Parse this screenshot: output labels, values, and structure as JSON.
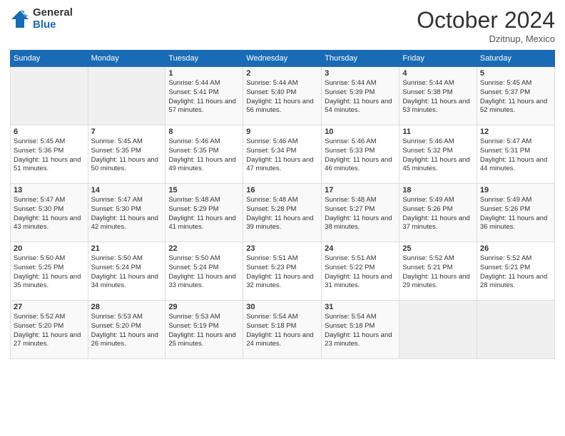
{
  "logo": {
    "general": "General",
    "blue": "Blue"
  },
  "header": {
    "month": "October 2024",
    "location": "Dzitnup, Mexico"
  },
  "weekdays": [
    "Sunday",
    "Monday",
    "Tuesday",
    "Wednesday",
    "Thursday",
    "Friday",
    "Saturday"
  ],
  "weeks": [
    [
      {
        "day": "",
        "sunrise": "",
        "sunset": "",
        "daylight": ""
      },
      {
        "day": "",
        "sunrise": "",
        "sunset": "",
        "daylight": ""
      },
      {
        "day": "1",
        "sunrise": "Sunrise: 5:44 AM",
        "sunset": "Sunset: 5:41 PM",
        "daylight": "Daylight: 11 hours and 57 minutes."
      },
      {
        "day": "2",
        "sunrise": "Sunrise: 5:44 AM",
        "sunset": "Sunset: 5:40 PM",
        "daylight": "Daylight: 11 hours and 56 minutes."
      },
      {
        "day": "3",
        "sunrise": "Sunrise: 5:44 AM",
        "sunset": "Sunset: 5:39 PM",
        "daylight": "Daylight: 11 hours and 54 minutes."
      },
      {
        "day": "4",
        "sunrise": "Sunrise: 5:44 AM",
        "sunset": "Sunset: 5:38 PM",
        "daylight": "Daylight: 11 hours and 53 minutes."
      },
      {
        "day": "5",
        "sunrise": "Sunrise: 5:45 AM",
        "sunset": "Sunset: 5:37 PM",
        "daylight": "Daylight: 11 hours and 52 minutes."
      }
    ],
    [
      {
        "day": "6",
        "sunrise": "Sunrise: 5:45 AM",
        "sunset": "Sunset: 5:36 PM",
        "daylight": "Daylight: 11 hours and 51 minutes."
      },
      {
        "day": "7",
        "sunrise": "Sunrise: 5:45 AM",
        "sunset": "Sunset: 5:35 PM",
        "daylight": "Daylight: 11 hours and 50 minutes."
      },
      {
        "day": "8",
        "sunrise": "Sunrise: 5:46 AM",
        "sunset": "Sunset: 5:35 PM",
        "daylight": "Daylight: 11 hours and 49 minutes."
      },
      {
        "day": "9",
        "sunrise": "Sunrise: 5:46 AM",
        "sunset": "Sunset: 5:34 PM",
        "daylight": "Daylight: 11 hours and 47 minutes."
      },
      {
        "day": "10",
        "sunrise": "Sunrise: 5:46 AM",
        "sunset": "Sunset: 5:33 PM",
        "daylight": "Daylight: 11 hours and 46 minutes."
      },
      {
        "day": "11",
        "sunrise": "Sunrise: 5:46 AM",
        "sunset": "Sunset: 5:32 PM",
        "daylight": "Daylight: 11 hours and 45 minutes."
      },
      {
        "day": "12",
        "sunrise": "Sunrise: 5:47 AM",
        "sunset": "Sunset: 5:31 PM",
        "daylight": "Daylight: 11 hours and 44 minutes."
      }
    ],
    [
      {
        "day": "13",
        "sunrise": "Sunrise: 5:47 AM",
        "sunset": "Sunset: 5:30 PM",
        "daylight": "Daylight: 11 hours and 43 minutes."
      },
      {
        "day": "14",
        "sunrise": "Sunrise: 5:47 AM",
        "sunset": "Sunset: 5:30 PM",
        "daylight": "Daylight: 11 hours and 42 minutes."
      },
      {
        "day": "15",
        "sunrise": "Sunrise: 5:48 AM",
        "sunset": "Sunset: 5:29 PM",
        "daylight": "Daylight: 11 hours and 41 minutes."
      },
      {
        "day": "16",
        "sunrise": "Sunrise: 5:48 AM",
        "sunset": "Sunset: 5:28 PM",
        "daylight": "Daylight: 11 hours and 39 minutes."
      },
      {
        "day": "17",
        "sunrise": "Sunrise: 5:48 AM",
        "sunset": "Sunset: 5:27 PM",
        "daylight": "Daylight: 11 hours and 38 minutes."
      },
      {
        "day": "18",
        "sunrise": "Sunrise: 5:49 AM",
        "sunset": "Sunset: 5:26 PM",
        "daylight": "Daylight: 11 hours and 37 minutes."
      },
      {
        "day": "19",
        "sunrise": "Sunrise: 5:49 AM",
        "sunset": "Sunset: 5:26 PM",
        "daylight": "Daylight: 11 hours and 36 minutes."
      }
    ],
    [
      {
        "day": "20",
        "sunrise": "Sunrise: 5:50 AM",
        "sunset": "Sunset: 5:25 PM",
        "daylight": "Daylight: 11 hours and 35 minutes."
      },
      {
        "day": "21",
        "sunrise": "Sunrise: 5:50 AM",
        "sunset": "Sunset: 5:24 PM",
        "daylight": "Daylight: 11 hours and 34 minutes."
      },
      {
        "day": "22",
        "sunrise": "Sunrise: 5:50 AM",
        "sunset": "Sunset: 5:24 PM",
        "daylight": "Daylight: 11 hours and 33 minutes."
      },
      {
        "day": "23",
        "sunrise": "Sunrise: 5:51 AM",
        "sunset": "Sunset: 5:23 PM",
        "daylight": "Daylight: 11 hours and 32 minutes."
      },
      {
        "day": "24",
        "sunrise": "Sunrise: 5:51 AM",
        "sunset": "Sunset: 5:22 PM",
        "daylight": "Daylight: 11 hours and 31 minutes."
      },
      {
        "day": "25",
        "sunrise": "Sunrise: 5:52 AM",
        "sunset": "Sunset: 5:21 PM",
        "daylight": "Daylight: 11 hours and 29 minutes."
      },
      {
        "day": "26",
        "sunrise": "Sunrise: 5:52 AM",
        "sunset": "Sunset: 5:21 PM",
        "daylight": "Daylight: 11 hours and 28 minutes."
      }
    ],
    [
      {
        "day": "27",
        "sunrise": "Sunrise: 5:52 AM",
        "sunset": "Sunset: 5:20 PM",
        "daylight": "Daylight: 11 hours and 27 minutes."
      },
      {
        "day": "28",
        "sunrise": "Sunrise: 5:53 AM",
        "sunset": "Sunset: 5:20 PM",
        "daylight": "Daylight: 11 hours and 26 minutes."
      },
      {
        "day": "29",
        "sunrise": "Sunrise: 5:53 AM",
        "sunset": "Sunset: 5:19 PM",
        "daylight": "Daylight: 11 hours and 25 minutes."
      },
      {
        "day": "30",
        "sunrise": "Sunrise: 5:54 AM",
        "sunset": "Sunset: 5:18 PM",
        "daylight": "Daylight: 11 hours and 24 minutes."
      },
      {
        "day": "31",
        "sunrise": "Sunrise: 5:54 AM",
        "sunset": "Sunset: 5:18 PM",
        "daylight": "Daylight: 11 hours and 23 minutes."
      },
      {
        "day": "",
        "sunrise": "",
        "sunset": "",
        "daylight": ""
      },
      {
        "day": "",
        "sunrise": "",
        "sunset": "",
        "daylight": ""
      }
    ]
  ]
}
